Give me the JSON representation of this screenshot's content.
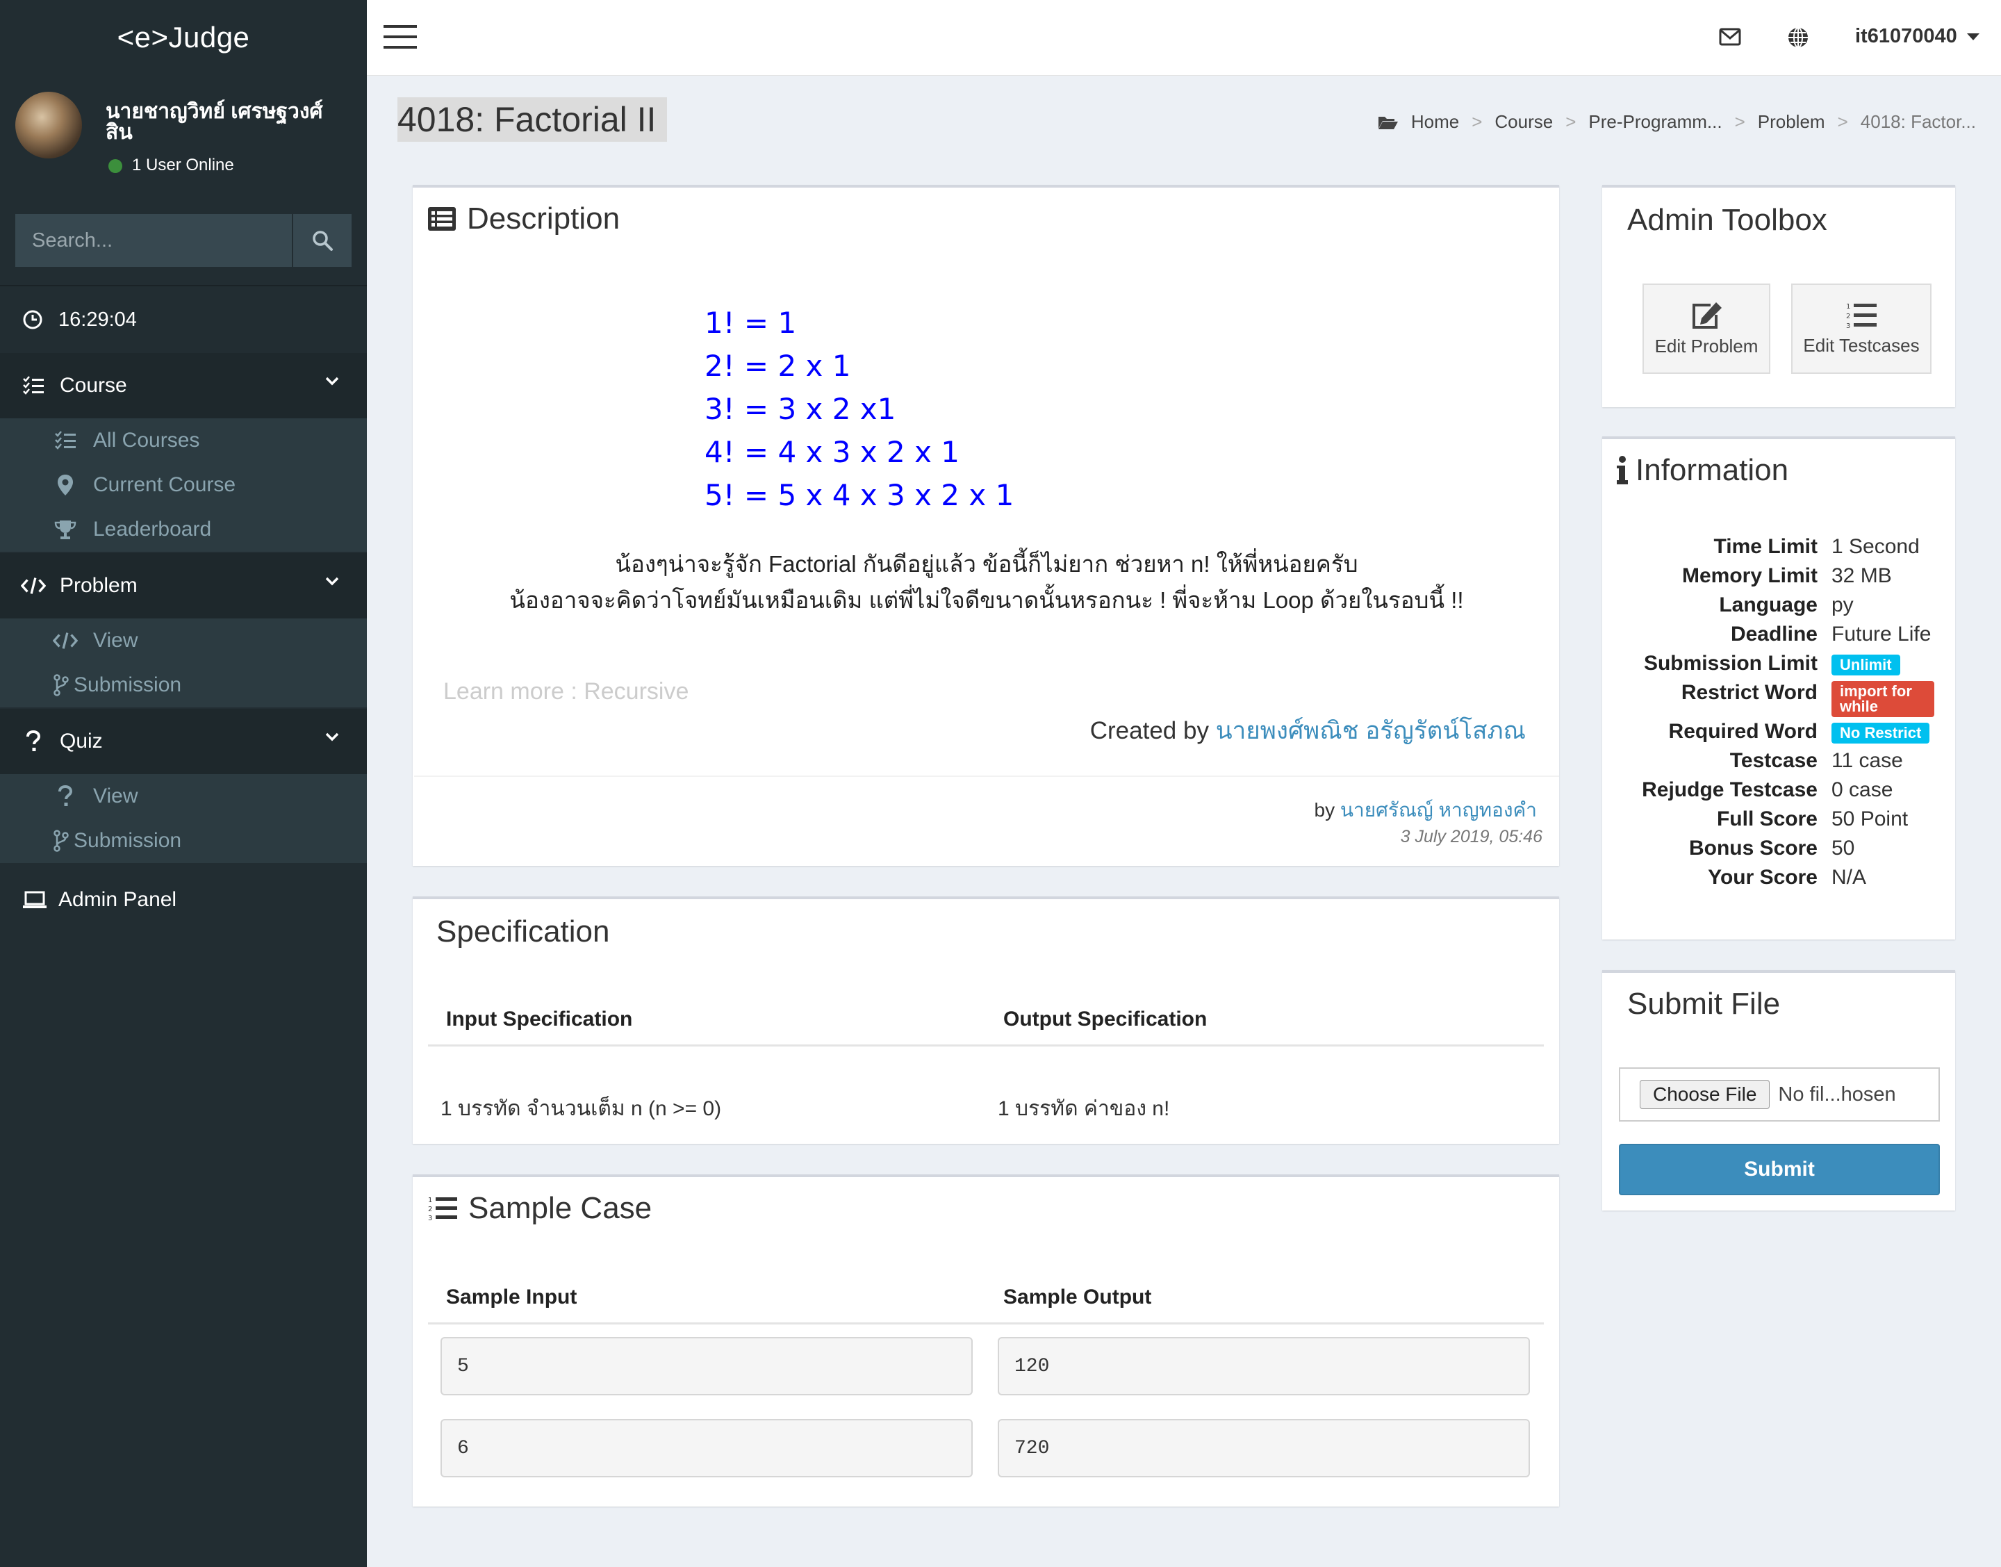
{
  "app": {
    "logo": "<e>Judge"
  },
  "sidebar": {
    "user_name": "นายชาญวิทย์ เศรษฐวงศ์สิน",
    "online_text": "1 User Online",
    "search_placeholder": "Search...",
    "clock": "16:29:04",
    "course": {
      "label": "Course",
      "items": [
        {
          "label": "All Courses",
          "icon": "list-check-icon"
        },
        {
          "label": "Current Course",
          "icon": "map-marker-icon"
        },
        {
          "label": "Leaderboard",
          "icon": "trophy-icon"
        }
      ]
    },
    "problem": {
      "label": "Problem",
      "items": [
        {
          "label": "View",
          "icon": "code-icon"
        },
        {
          "label": "Submission",
          "icon": "code-fork-icon"
        }
      ]
    },
    "quiz": {
      "label": "Quiz",
      "items": [
        {
          "label": "View",
          "icon": "question-icon"
        },
        {
          "label": "Submission",
          "icon": "code-fork-icon"
        }
      ]
    },
    "admin_panel": "Admin Panel"
  },
  "topbar": {
    "username": "it61070040"
  },
  "page": {
    "title": "4018: Factorial II",
    "breadcrumb": [
      "Home",
      "Course",
      "Pre-Programm...",
      "Problem",
      "4018: Factor..."
    ]
  },
  "description": {
    "title": "Description",
    "formulas": [
      "1! = 1",
      "2! = 2 x 1",
      "3! = 3 x 2 x1",
      "4! = 4 x 3 x 2 x 1",
      "5! = 5 x 4 x 3 x 2 x 1"
    ],
    "text_line1": "น้องๆน่าจะรู้จัก Factorial กันดีอยู่แล้ว ข้อนี้ก็ไม่ยาก ช่วยหา n! ให้พี่หน่อยครับ",
    "text_line2": "น้องอาจจะคิดว่าโจทย์มันเหมือนเดิม แต่พี่ไม่ใจดีขนาดนั้นหรอกนะ ! พี่จะห้าม Loop ด้วยในรอบนี้ !!",
    "learn_more": "Learn more : Recursive",
    "created_by_label": "Created by",
    "created_by_name": "นายพงศ์พณิช อรัญรัตน์โสภณ",
    "by_label": "by",
    "by_name": "นายศรัณญ์ หาญทองคำ",
    "date": "3 July 2019, 05:46"
  },
  "specification": {
    "title": "Specification",
    "input_header": "Input Specification",
    "output_header": "Output Specification",
    "input_value": "1 บรรทัด จำนวนเต็ม n (n >= 0)",
    "output_value": "1 บรรทัด ค่าของ n!"
  },
  "sample_case": {
    "title": "Sample Case",
    "input_header": "Sample Input",
    "output_header": "Sample Output",
    "rows": [
      {
        "input": "5",
        "output": "120"
      },
      {
        "input": "6",
        "output": "720"
      }
    ]
  },
  "admin_toolbox": {
    "title": "Admin Toolbox",
    "edit_problem": "Edit Problem",
    "edit_testcases": "Edit Testcases"
  },
  "information": {
    "title": "Information",
    "rows": [
      {
        "label": "Time Limit",
        "value": "1 Second"
      },
      {
        "label": "Memory Limit",
        "value": "32 MB"
      },
      {
        "label": "Language",
        "value": "py"
      },
      {
        "label": "Deadline",
        "value": "Future Life"
      },
      {
        "label": "Submission Limit",
        "badge": "Unlimit",
        "badge_color": "#00c0ef"
      },
      {
        "label": "Restrict Word",
        "badge": "import for while",
        "badge_color": "#dd4b39"
      },
      {
        "label": "Required Word",
        "badge": "No Restrict",
        "badge_color": "#00c0ef"
      },
      {
        "label": "Testcase",
        "value": "11 case"
      },
      {
        "label": "Rejudge Testcase",
        "value": "0 case"
      },
      {
        "label": "Full Score",
        "value": "50 Point"
      },
      {
        "label": "Bonus Score",
        "value": "50"
      },
      {
        "label": "Your Score",
        "value": "N/A"
      }
    ]
  },
  "submit_file": {
    "title": "Submit File",
    "choose_label": "Choose File",
    "file_status": "No fil...hosen",
    "submit_label": "Submit"
  },
  "colors": {
    "sidebar_bg": "#222d32",
    "accent": "#3c8dbc",
    "formula_blue": "#0000ff",
    "badge_info": "#00c0ef",
    "badge_danger": "#dd4b39"
  }
}
